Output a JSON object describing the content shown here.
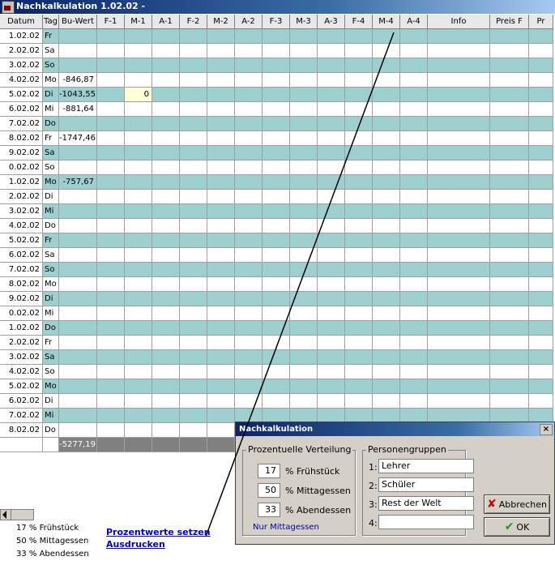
{
  "window": {
    "title": "Nachkalkulation  1.02.02 -"
  },
  "columns": [
    "Datum",
    "Tag",
    "Bu-Wert",
    "F-1",
    "M-1",
    "A-1",
    "F-2",
    "M-2",
    "A-2",
    "F-3",
    "M-3",
    "A-3",
    "F-4",
    "M-4",
    "A-4",
    "Info",
    "Preis F",
    "Pr"
  ],
  "rows": [
    {
      "datum": "1.02.02",
      "tag": "Fr",
      "buwert": ""
    },
    {
      "datum": "2.02.02",
      "tag": "Sa",
      "buwert": ""
    },
    {
      "datum": "3.02.02",
      "tag": "So",
      "buwert": ""
    },
    {
      "datum": "4.02.02",
      "tag": "Mo",
      "buwert": "-846,87"
    },
    {
      "datum": "5.02.02",
      "tag": "Di",
      "buwert": "-1043,55",
      "m1": "0"
    },
    {
      "datum": "6.02.02",
      "tag": "Mi",
      "buwert": "-881,64"
    },
    {
      "datum": "7.02.02",
      "tag": "Do",
      "buwert": ""
    },
    {
      "datum": "8.02.02",
      "tag": "Fr",
      "buwert": "-1747,46"
    },
    {
      "datum": "9.02.02",
      "tag": "Sa",
      "buwert": ""
    },
    {
      "datum": "0.02.02",
      "tag": "So",
      "buwert": ""
    },
    {
      "datum": "1.02.02",
      "tag": "Mo",
      "buwert": "-757,67"
    },
    {
      "datum": "2.02.02",
      "tag": "Di",
      "buwert": ""
    },
    {
      "datum": "3.02.02",
      "tag": "Mi",
      "buwert": ""
    },
    {
      "datum": "4.02.02",
      "tag": "Do",
      "buwert": ""
    },
    {
      "datum": "5.02.02",
      "tag": "Fr",
      "buwert": ""
    },
    {
      "datum": "6.02.02",
      "tag": "Sa",
      "buwert": ""
    },
    {
      "datum": "7.02.02",
      "tag": "So",
      "buwert": ""
    },
    {
      "datum": "8.02.02",
      "tag": "Mo",
      "buwert": ""
    },
    {
      "datum": "9.02.02",
      "tag": "Di",
      "buwert": ""
    },
    {
      "datum": "0.02.02",
      "tag": "Mi",
      "buwert": ""
    },
    {
      "datum": "1.02.02",
      "tag": "Do",
      "buwert": ""
    },
    {
      "datum": "2.02.02",
      "tag": "Fr",
      "buwert": ""
    },
    {
      "datum": "3.02.02",
      "tag": "Sa",
      "buwert": ""
    },
    {
      "datum": "4.02.02",
      "tag": "So",
      "buwert": ""
    },
    {
      "datum": "5.02.02",
      "tag": "Mo",
      "buwert": ""
    },
    {
      "datum": "6.02.02",
      "tag": "Di",
      "buwert": ""
    },
    {
      "datum": "7.02.02",
      "tag": "Mi",
      "buwert": ""
    },
    {
      "datum": "8.02.02",
      "tag": "Do",
      "buwert": ""
    }
  ],
  "total": "-5277,19",
  "summary": {
    "line1": "17  % Frühstück",
    "line2": "50  % Mittagessen",
    "line3": "33  % Abendessen",
    "link_set": "Prozentwerte setzen",
    "link_print": "Ausdrucken"
  },
  "dialog": {
    "title": "Nachkalkulation",
    "close": "×",
    "group_percent": "Prozentuelle Verteilung",
    "breakfast_value": "17",
    "breakfast_label": "% Frühstück",
    "lunch_value": "50",
    "lunch_label": "% Mittagessen",
    "dinner_value": "33",
    "dinner_label": "% Abendessen",
    "only_lunch": "Nur Mittagessen",
    "group_persons": "Personengruppen",
    "p1_label": "1:",
    "p1_value": "Lehrer",
    "p2_label": "2:",
    "p2_value": "Schüler",
    "p3_label": "3:",
    "p3_value": "Rest der Welt",
    "p4_label": "4:",
    "p4_value": "",
    "cancel": "Abbrechen",
    "ok": "OK"
  },
  "colors": {
    "teal": "#9ecfcf",
    "title": "#0a246a",
    "link": "#0000cc"
  }
}
